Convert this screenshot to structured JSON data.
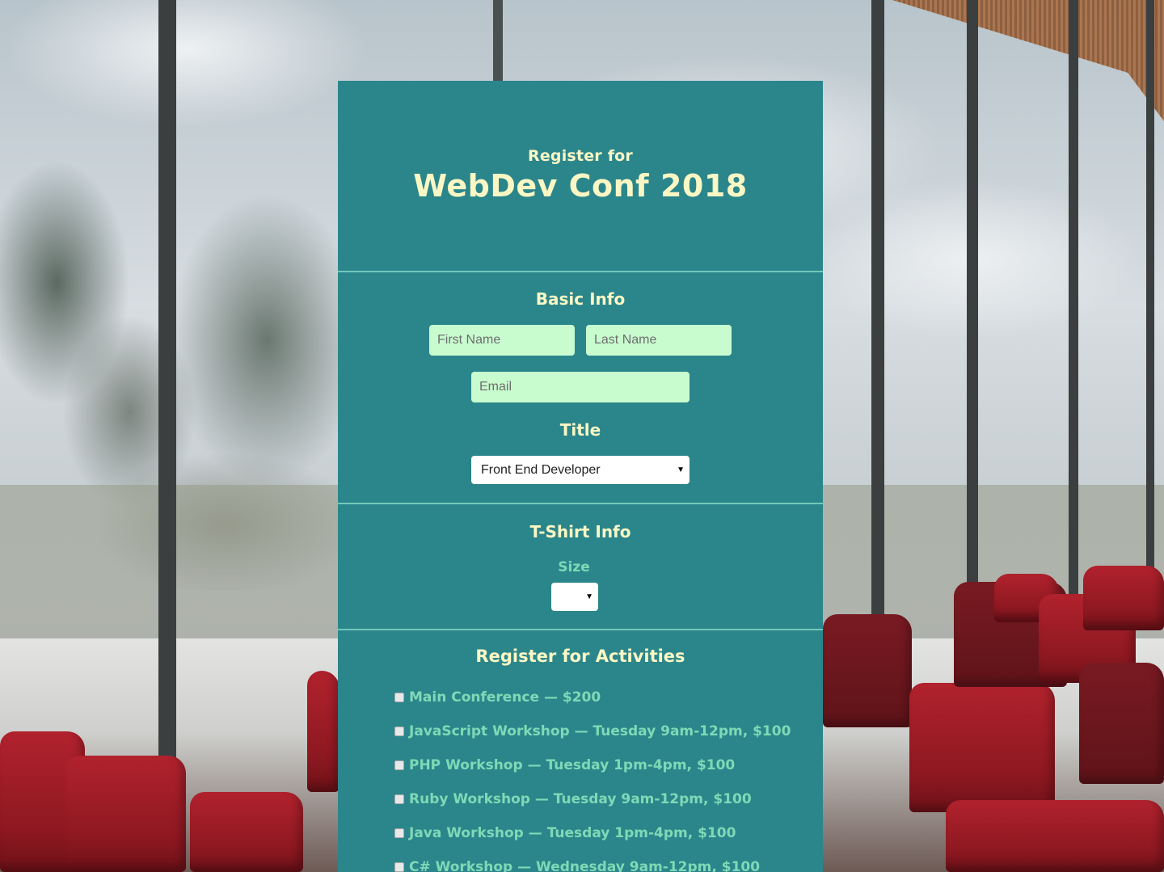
{
  "header": {
    "pre_title": "Register for",
    "title": "WebDev Conf 2018"
  },
  "basic_info": {
    "heading": "Basic Info",
    "first_name_placeholder": "First Name",
    "last_name_placeholder": "Last Name",
    "email_placeholder": "Email",
    "title_heading": "Title",
    "title_selected": "Front End Developer"
  },
  "tshirt": {
    "heading": "T-Shirt Info",
    "size_label": "Size",
    "size_selected": ""
  },
  "activities": {
    "heading": "Register for Activities",
    "items": [
      {
        "label": "Main Conference — $200",
        "checked": false
      },
      {
        "label": "JavaScript Workshop — Tuesday 9am-12pm, $100",
        "checked": false
      },
      {
        "label": "PHP Workshop — Tuesday 1pm-4pm, $100",
        "checked": false
      },
      {
        "label": "Ruby Workshop — Tuesday 9am-12pm, $100",
        "checked": false
      },
      {
        "label": "Java Workshop — Tuesday 1pm-4pm, $100",
        "checked": false
      },
      {
        "label": "C# Workshop — Wednesday 9am-12pm, $100",
        "checked": false
      }
    ]
  },
  "icons": {
    "dropdown": "caret-down-icon",
    "checkbox": "checkbox-icon"
  },
  "colors": {
    "panel": "#2b868b",
    "heading_text": "#fbf7c4",
    "label_text": "#7fd9b6",
    "input_bg": "#c8fccf",
    "divider": "#74c8b9"
  }
}
